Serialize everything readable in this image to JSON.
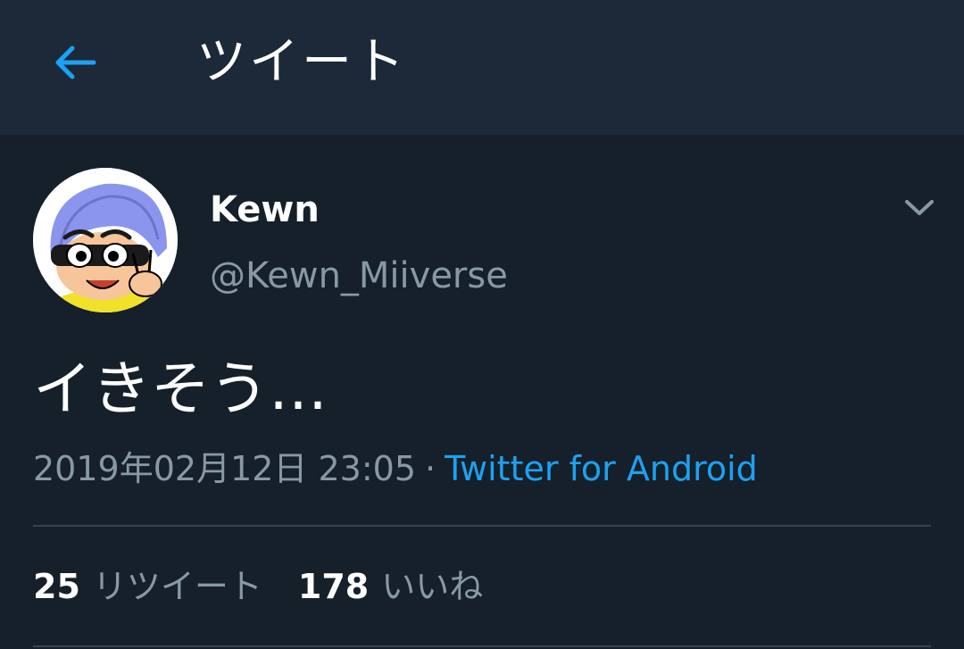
{
  "header": {
    "back_icon": "arrow-left-icon",
    "title": "ツイート",
    "accent_color": "#1da1f2"
  },
  "tweet": {
    "avatar_icon": "user-avatar-cartoon",
    "display_name": "Kewn",
    "handle": "@Kewn_Miiverse",
    "menu_icon": "chevron-down-icon",
    "text": "イきそう…",
    "timestamp": "2019年02月12日 23:05",
    "separator": "·",
    "source": "Twitter for Android"
  },
  "stats": {
    "retweets_count": "25",
    "retweets_label": "リツイート",
    "likes_count": "178",
    "likes_label": "いいね"
  },
  "colors": {
    "background": "#15202b",
    "header_background": "#1c2938",
    "secondary_text": "#8899a6",
    "link": "#1da1f2",
    "divider": "#38444d"
  }
}
